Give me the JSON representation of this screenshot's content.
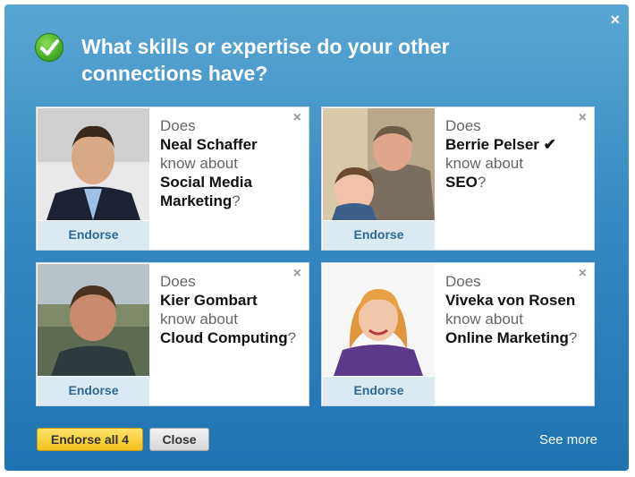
{
  "dialog": {
    "title": "What skills or expertise do your other connections have?",
    "close_icon": "×"
  },
  "cards": [
    {
      "line1": "Does",
      "name": "Neal Schaffer",
      "line2": "know about",
      "skill": "Social Media Marketing",
      "qmark": "?",
      "endorse": "Endorse",
      "dismiss": "×"
    },
    {
      "line1": "Does",
      "name": "Berrie Pelser ✔",
      "line2": "know about",
      "skill": "SEO",
      "qmark": "?",
      "endorse": "Endorse",
      "dismiss": "×"
    },
    {
      "line1": "Does",
      "name": "Kier Gombart",
      "line2": "know about",
      "skill": "Cloud Computing",
      "qmark": "?",
      "endorse": "Endorse",
      "dismiss": "×"
    },
    {
      "line1": "Does",
      "name": "Viveka von Rosen",
      "line2": "know about",
      "skill": "Online Marketing",
      "qmark": "?",
      "endorse": "Endorse",
      "dismiss": "×"
    }
  ],
  "footer": {
    "endorse_all": "Endorse all 4",
    "close": "Close",
    "see_more": "See more"
  },
  "colors": {
    "accent_blue": "#1f73b2",
    "endorse_text": "#2d6a96",
    "primary_button": "#f2c21c"
  }
}
